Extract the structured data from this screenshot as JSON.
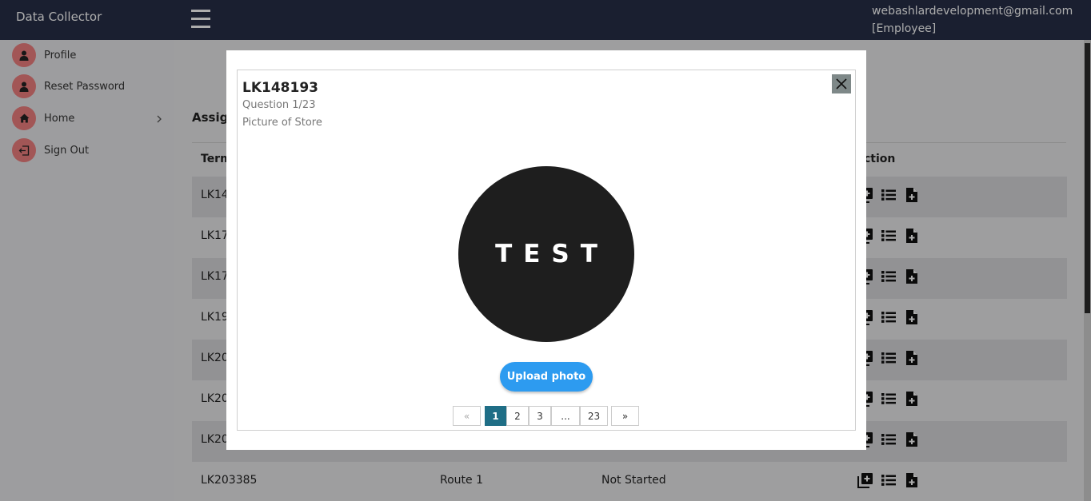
{
  "app": {
    "title": "Data Collector"
  },
  "topbar": {
    "email": "webashlardevelopment@gmail.com",
    "role": "[Employee]"
  },
  "sidebar": {
    "items": [
      {
        "label": "Profile",
        "icon": "user-icon"
      },
      {
        "label": "Reset Password",
        "icon": "user-icon"
      },
      {
        "label": "Home",
        "icon": "home-icon",
        "has_submenu": true
      },
      {
        "label": "Sign Out",
        "icon": "sign-out-icon"
      }
    ]
  },
  "main": {
    "section_title_partial": "Assig",
    "headers": {
      "terminal_partial": "Term",
      "action_partial": "ction"
    },
    "rows": [
      {
        "terminal": "LK14"
      },
      {
        "terminal": "LK17"
      },
      {
        "terminal": "LK17"
      },
      {
        "terminal": "LK19"
      },
      {
        "terminal": "LK20"
      },
      {
        "terminal": "LK20"
      },
      {
        "terminal": "LK20"
      },
      {
        "terminal": "LK203385",
        "route": "Route 1",
        "status": "Not Started"
      }
    ]
  },
  "modal": {
    "title": "LK148193",
    "question": "Question 1/23",
    "question_text": "Picture of Store",
    "photo_text": "TEST",
    "upload_label": "Upload photo",
    "pagination": {
      "prev": "«",
      "pages": [
        "1",
        "2",
        "3",
        "...",
        "23"
      ],
      "next": "»",
      "current": "1"
    }
  },
  "colors": {
    "topbar": "#272f48",
    "menu_icon_bg": "#ef7f7f",
    "upload_button": "#2d9bf0",
    "active_page": "#1f6e86",
    "close_button": "#7e8888"
  }
}
